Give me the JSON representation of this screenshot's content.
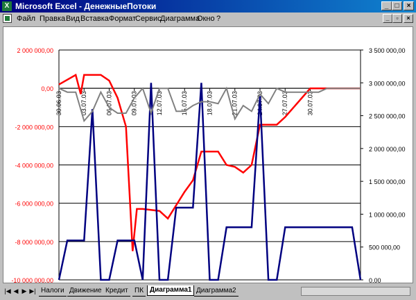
{
  "window": {
    "title": "Microsoft Excel - ДенежныеПотоки"
  },
  "menu": [
    "Файл",
    "Правка",
    "Вид",
    "Вставка",
    "Формат",
    "Сервис",
    "Диаграмма",
    "Окно",
    "?"
  ],
  "sheet_tabs": [
    "Налоги",
    "Движение",
    "Кредит",
    "ПК",
    "Диаграмма1",
    "Диаграмма2"
  ],
  "active_tab": "Диаграмма1",
  "colors": {
    "red_series": "#ff0000",
    "navy_series": "#000080",
    "gray_series": "#808080",
    "title_bar": "#000080"
  },
  "chart_data": {
    "type": "line",
    "x_labels": [
      "30.06.03",
      "03.07.03",
      "06.07.03",
      "09.07.03",
      "12.07.03",
      "15.07.03",
      "18.07.03",
      "21.07.03",
      "24.07.03",
      "27.07.03",
      "30.07.03"
    ],
    "y_left": {
      "range": [
        -10000000,
        2000000
      ],
      "ticks": [
        "2 000 000,00",
        "0,00",
        "-2 000 000,00",
        "-4 000 000,00",
        "-6 000 000,00",
        "-8 000 000,00",
        "-10 000 000,00"
      ]
    },
    "y_right": {
      "range": [
        0,
        3500000
      ],
      "ticks": [
        "3 500 000,00",
        "3 000 000,00",
        "2 500 000,00",
        "2 000 000,00",
        "1 500 000,00",
        "1 000 000,00",
        "500 000,00",
        "0,00"
      ]
    },
    "grid": true,
    "series": [
      {
        "axis": "left",
        "color": "#ff0000",
        "x": [
          0,
          2,
          2.6,
          3,
          4,
          5,
          6,
          7,
          8,
          8.8,
          9.3,
          10,
          12,
          13,
          15,
          16,
          17,
          18,
          19,
          20,
          21,
          22,
          23,
          24,
          25,
          26,
          27,
          28,
          29,
          30,
          31,
          32,
          33,
          34,
          35,
          36
        ],
        "y": [
          200000,
          700000,
          -300000,
          700000,
          700000,
          700000,
          400000,
          -500000,
          -2000000,
          -8500000,
          -6300000,
          -6300000,
          -6400000,
          -6800000,
          -5400000,
          -4800000,
          -3300000,
          -3300000,
          -3300000,
          -4000000,
          -4100000,
          -4400000,
          -4000000,
          -1900000,
          -1900000,
          -1900000,
          -1500000,
          -1000000,
          -500000,
          0,
          0,
          0,
          0,
          0,
          0,
          0
        ]
      },
      {
        "axis": "right",
        "color": "#000080",
        "x": [
          0,
          1,
          2,
          3,
          4,
          5,
          6,
          7,
          8,
          9,
          10,
          11,
          12,
          13,
          14,
          15,
          16,
          17,
          18,
          19,
          20,
          21,
          22,
          23,
          24,
          25,
          26,
          27,
          28,
          29,
          30,
          31,
          32,
          33,
          34,
          35,
          36
        ],
        "y": [
          0,
          600000,
          600000,
          600000,
          2600000,
          0,
          0,
          600000,
          600000,
          600000,
          0,
          3000000,
          0,
          0,
          1100000,
          1100000,
          1100000,
          3000000,
          0,
          0,
          800000,
          800000,
          800000,
          800000,
          2800000,
          0,
          0,
          800000,
          800000,
          800000,
          800000,
          800000,
          800000,
          800000,
          800000,
          800000,
          0
        ]
      },
      {
        "axis": "left",
        "color": "#808080",
        "x": [
          0,
          1,
          2,
          3,
          4,
          5,
          6,
          7,
          8,
          9,
          10,
          11,
          12,
          13,
          14,
          15,
          16,
          17,
          18,
          19,
          20,
          21,
          22,
          23,
          24,
          25,
          26,
          27,
          28,
          29,
          30,
          31,
          32,
          33,
          34,
          35,
          36
        ],
        "y": [
          0,
          -200000,
          -200000,
          -1700000,
          -1200000,
          -200000,
          -1000000,
          -1300000,
          -1300000,
          -500000,
          0,
          -1300000,
          0,
          0,
          -1200000,
          -1200000,
          -900000,
          -700000,
          -700000,
          -800000,
          0,
          -1600000,
          -900000,
          -1200000,
          -300000,
          -800000,
          0,
          -200000,
          -200000,
          -200000,
          -200000,
          -200000,
          0,
          0,
          0,
          0,
          0
        ]
      }
    ]
  }
}
